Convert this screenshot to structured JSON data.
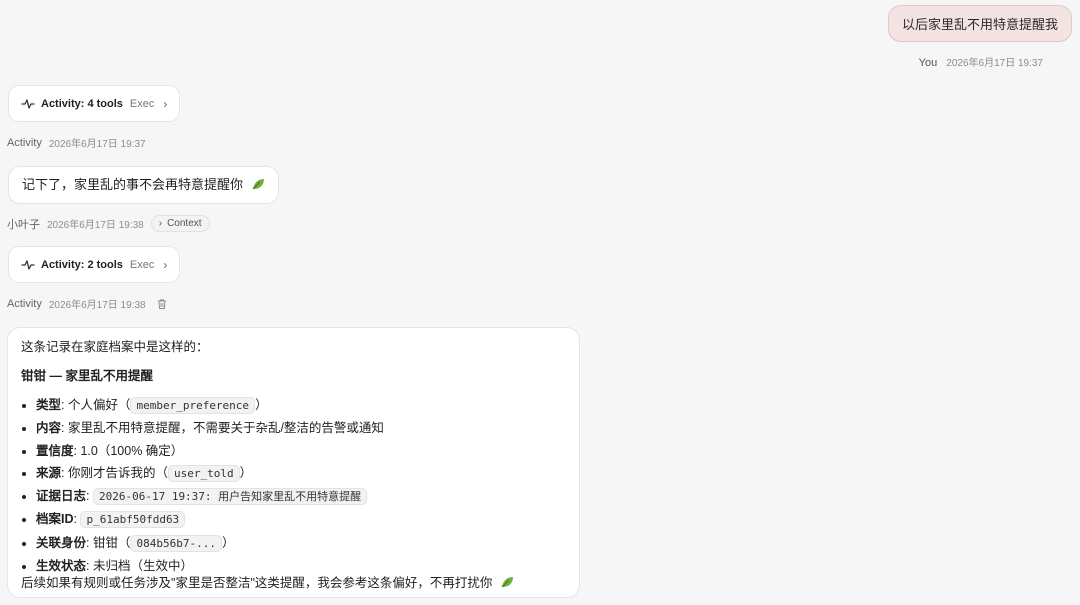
{
  "user_message": {
    "text": "以后家里乱不用特意提醒我",
    "sender": "You",
    "timestamp": "2026年6月17日 19:37"
  },
  "activity_1": {
    "title": "Activity: 4 tools",
    "exec": "Exec",
    "meta_label": "Activity",
    "timestamp": "2026年6月17日 19:37"
  },
  "assistant_reply": {
    "text": "记下了，家里乱的事不会再特意提醒你",
    "sender": "小叶子",
    "timestamp": "2026年6月17日 19:38",
    "context_label": "Context"
  },
  "activity_2": {
    "title": "Activity: 2 tools",
    "exec": "Exec",
    "meta_label": "Activity",
    "timestamp": "2026年6月17日 19:38"
  },
  "record_card": {
    "intro": "这条记录在家庭档案中是这样的：",
    "heading": "钳钳 — 家里乱不用提醒",
    "items": [
      {
        "label": "类型",
        "pre": ": 个人偏好（",
        "code": "member_preference",
        "post": "）"
      },
      {
        "label": "内容",
        "pre": ": 家里乱不用特意提醒，不需要关于杂乱/整洁的告警或通知",
        "code": "",
        "post": ""
      },
      {
        "label": "置信度",
        "pre": ": 1.0（100% 确定）",
        "code": "",
        "post": ""
      },
      {
        "label": "来源",
        "pre": ": 你刚才告诉我的（",
        "code": "user_told",
        "post": "）"
      },
      {
        "label": "证据日志",
        "pre": ": ",
        "code": "2026-06-17 19:37: 用户告知家里乱不用特意提醒",
        "post": ""
      },
      {
        "label": "档案ID",
        "pre": ": ",
        "code": "p_61abf50fdd63",
        "post": ""
      },
      {
        "label": "关联身份",
        "pre": ": 钳钳（",
        "code": "084b56b7-...",
        "post": "）"
      },
      {
        "label": "生效状态",
        "pre": ": 未归档（生效中）",
        "code": "",
        "post": ""
      }
    ],
    "outro": "后续如果有规则或任务涉及\"家里是否整洁\"这类提醒，我会参考这条偏好，不再打扰你"
  }
}
